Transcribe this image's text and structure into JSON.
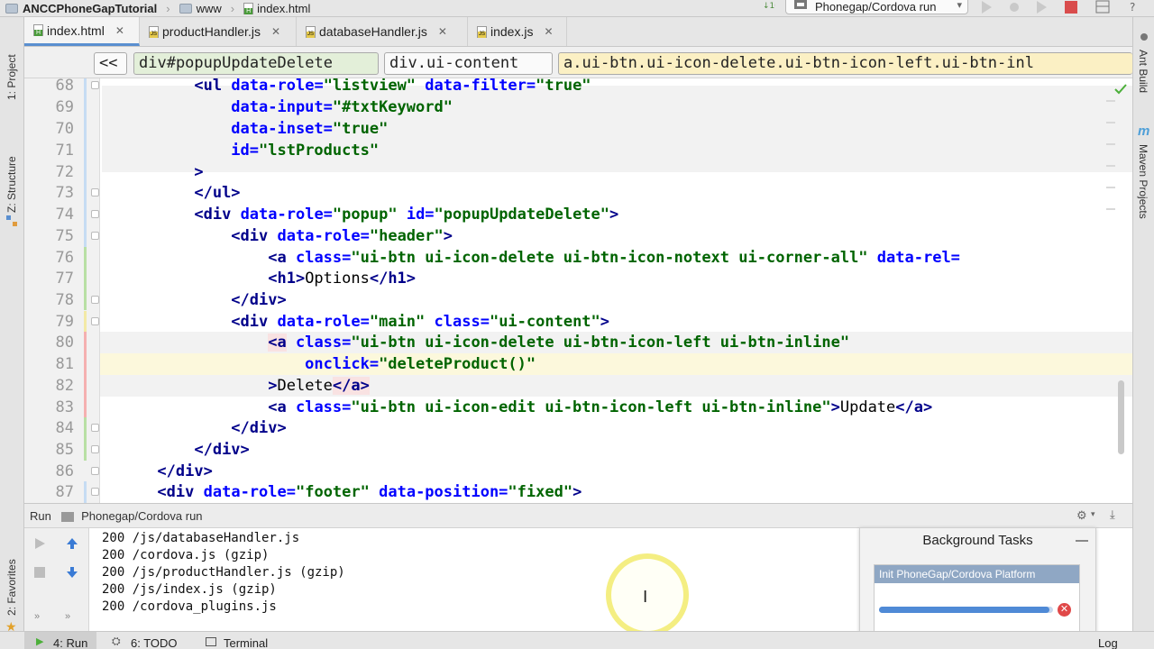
{
  "breadcrumb": {
    "project": "ANCCPhoneGapTutorial",
    "folder": "www",
    "file": "index.html"
  },
  "toolbar": {
    "run_config": "Phonegap/Cordova run"
  },
  "left_tool_tabs": [
    "1: Project",
    "Z: Structure",
    "2: Favorites"
  ],
  "right_tool_tabs": [
    "Ant Build",
    "Maven Projects"
  ],
  "tabs": [
    {
      "label": "index.html",
      "type": "html",
      "active": true
    },
    {
      "label": "productHandler.js",
      "type": "js",
      "active": false
    },
    {
      "label": "databaseHandler.js",
      "type": "js",
      "active": false
    },
    {
      "label": "index.js",
      "type": "js",
      "active": false
    }
  ],
  "nav": {
    "back": "<<",
    "crumbs": [
      "div#popupUpdateDelete",
      "div.ui-content",
      "a.ui-btn.ui-icon-delete.ui-btn-icon-left.ui-btn-inl"
    ]
  },
  "code": {
    "line_numbers": [
      "68",
      "69",
      "70",
      "71",
      "72",
      "73",
      "74",
      "75",
      "76",
      "77",
      "78",
      "79",
      "80",
      "81",
      "82",
      "83",
      "84",
      "85",
      "86",
      "87"
    ],
    "current_line": "81"
  },
  "run_panel": {
    "label": "Run",
    "config": "Phonegap/Cordova run",
    "log": [
      "200 /js/databaseHandler.js",
      "200 /cordova.js (gzip)",
      "200 /js/productHandler.js (gzip)",
      "200 /js/index.js (gzip)",
      "200 /cordova_plugins.js"
    ]
  },
  "background_tasks": {
    "title": "Background Tasks",
    "task": "Init PhoneGap/Cordova Platform",
    "progress": 0.98
  },
  "bottom_tabs": [
    "4: Run",
    "6: TODO",
    "Terminal",
    "Log"
  ],
  "colors": {
    "accent": "#5a8fd0",
    "tag": "#00008a",
    "attr": "#0000ff",
    "value": "#006400"
  }
}
